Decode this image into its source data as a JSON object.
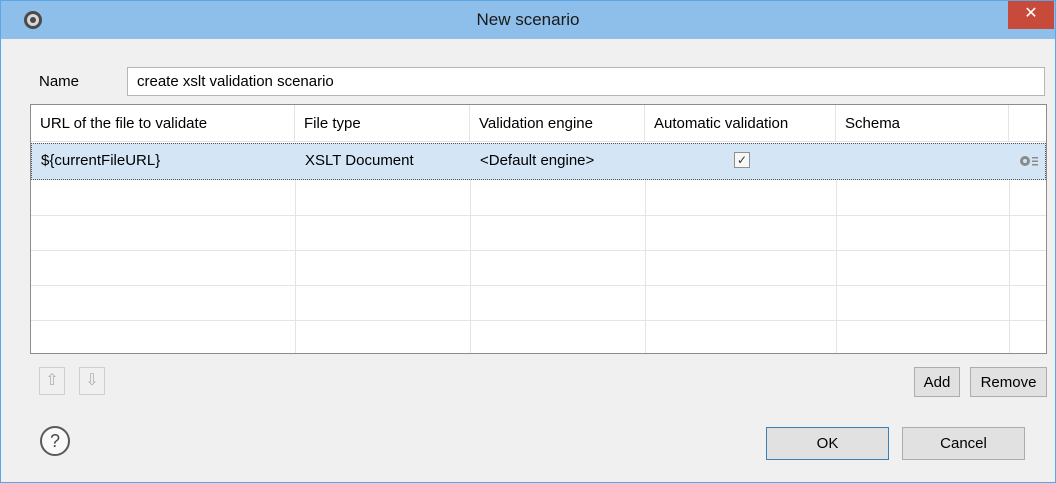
{
  "window": {
    "title": "New scenario",
    "close_glyph": "✕",
    "app_icon": "gear-app-icon"
  },
  "name_field": {
    "label": "Name",
    "value": "create xslt validation scenario"
  },
  "table": {
    "columns": [
      "URL of the file to validate",
      "File type",
      "Validation engine",
      "Automatic validation",
      "Schema"
    ],
    "rows": [
      {
        "url": "${currentFileURL}",
        "file_type": "XSLT Document",
        "engine": "<Default engine>",
        "automatic_validation": true,
        "schema": "",
        "selected": true
      }
    ]
  },
  "buttons": {
    "move_up": "⇧",
    "move_down": "⇩",
    "add": "Add",
    "remove": "Remove",
    "ok": "OK",
    "cancel": "Cancel",
    "help": "?"
  },
  "colors": {
    "titlebar": "#8dbfea",
    "close": "#c84a3b",
    "selection": "#d4e6f6"
  }
}
